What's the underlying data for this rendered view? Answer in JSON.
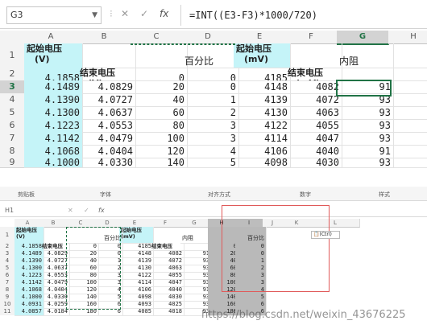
{
  "formula_bar": {
    "name_box": "G3",
    "formula": "=INT((E3-F3)*1000/720)",
    "cancel_glyph": "✕",
    "enter_glyph": "✓",
    "fx_glyph": "fx"
  },
  "top": {
    "columns": [
      "A",
      "B",
      "C",
      "D",
      "E",
      "F",
      "G",
      "H"
    ],
    "rows": [
      "1",
      "2",
      "3",
      "4",
      "5",
      "6",
      "7",
      "8",
      "9"
    ],
    "headers": {
      "A1": "起始电压\n(V)",
      "B2": "结束电压\n(V)",
      "D1": "百分比",
      "E1": "起始电压\n(mV)",
      "F2": "结束电压\n(mV)",
      "G1": "内阻"
    },
    "data": [
      [
        "4.1858",
        "",
        "0",
        "0",
        "4185",
        "",
        ""
      ],
      [
        "4.1489",
        "4.0829",
        "20",
        "0",
        "4148",
        "4082",
        "91"
      ],
      [
        "4.1390",
        "4.0727",
        "40",
        "1",
        "4139",
        "4072",
        "93"
      ],
      [
        "4.1300",
        "4.0637",
        "60",
        "2",
        "4130",
        "4063",
        "93"
      ],
      [
        "4.1223",
        "4.0553",
        "80",
        "3",
        "4122",
        "4055",
        "93"
      ],
      [
        "4.1142",
        "4.0479",
        "100",
        "3",
        "4114",
        "4047",
        "93"
      ],
      [
        "4.1068",
        "4.0404",
        "120",
        "4",
        "4106",
        "4040",
        "91"
      ],
      [
        "4.1000",
        "4.0330",
        "140",
        "5",
        "4098",
        "4030",
        "93"
      ]
    ]
  },
  "bottom": {
    "ribbon": [
      "剪贴板",
      "字体",
      "对齐方式",
      "数字",
      "样式"
    ],
    "name_box": "H1",
    "columns": [
      "A",
      "B",
      "C",
      "D",
      "E",
      "F",
      "G",
      "H",
      "I",
      "J",
      "K",
      "L"
    ],
    "rows": [
      "1",
      "2",
      "3",
      "4",
      "5",
      "6",
      "7",
      "8",
      "9",
      "10",
      "11"
    ],
    "headers": {
      "A1": "起始电压\n(V)",
      "B2": "结束电压\n(V)",
      "D1": "百分比",
      "E1": "起始电压\n(mV)",
      "F2": "结束电压\n(mV)",
      "G1": "内阻",
      "I1": "百分比"
    },
    "data": [
      [
        "4.1858",
        "",
        "0",
        "0",
        "4185",
        "",
        "",
        "0",
        "0"
      ],
      [
        "4.1489",
        "4.0829",
        "20",
        "0",
        "4148",
        "4082",
        "91",
        "20",
        "0"
      ],
      [
        "4.1390",
        "4.0727",
        "40",
        "1",
        "4139",
        "4072",
        "93",
        "40",
        "1"
      ],
      [
        "4.1300",
        "4.0637",
        "60",
        "2",
        "4130",
        "4063",
        "93",
        "60",
        "2"
      ],
      [
        "4.1223",
        "4.0553",
        "80",
        "3",
        "4122",
        "4055",
        "93",
        "80",
        "3"
      ],
      [
        "4.1142",
        "4.0479",
        "100",
        "3",
        "4114",
        "4047",
        "93",
        "100",
        "3"
      ],
      [
        "4.1068",
        "4.0404",
        "120",
        "4",
        "4106",
        "4040",
        "91",
        "120",
        "4"
      ],
      [
        "4.1000",
        "4.0330",
        "140",
        "5",
        "4098",
        "4030",
        "93",
        "140",
        "5"
      ],
      [
        "4.0931",
        "4.0259",
        "160",
        "6",
        "4093",
        "4025",
        "93",
        "160",
        "6"
      ],
      [
        "4.0857",
        "4.0184",
        "180",
        "6",
        "4085",
        "4018",
        "93",
        "180",
        "6"
      ]
    ],
    "paste_tag": "(Ctrl)",
    "watermark": "https://blog.csdn.net/weixin_43676225"
  },
  "colors": {
    "cyan": "#c5f4f8",
    "accent": "#217346",
    "red": "#e05a5a"
  }
}
